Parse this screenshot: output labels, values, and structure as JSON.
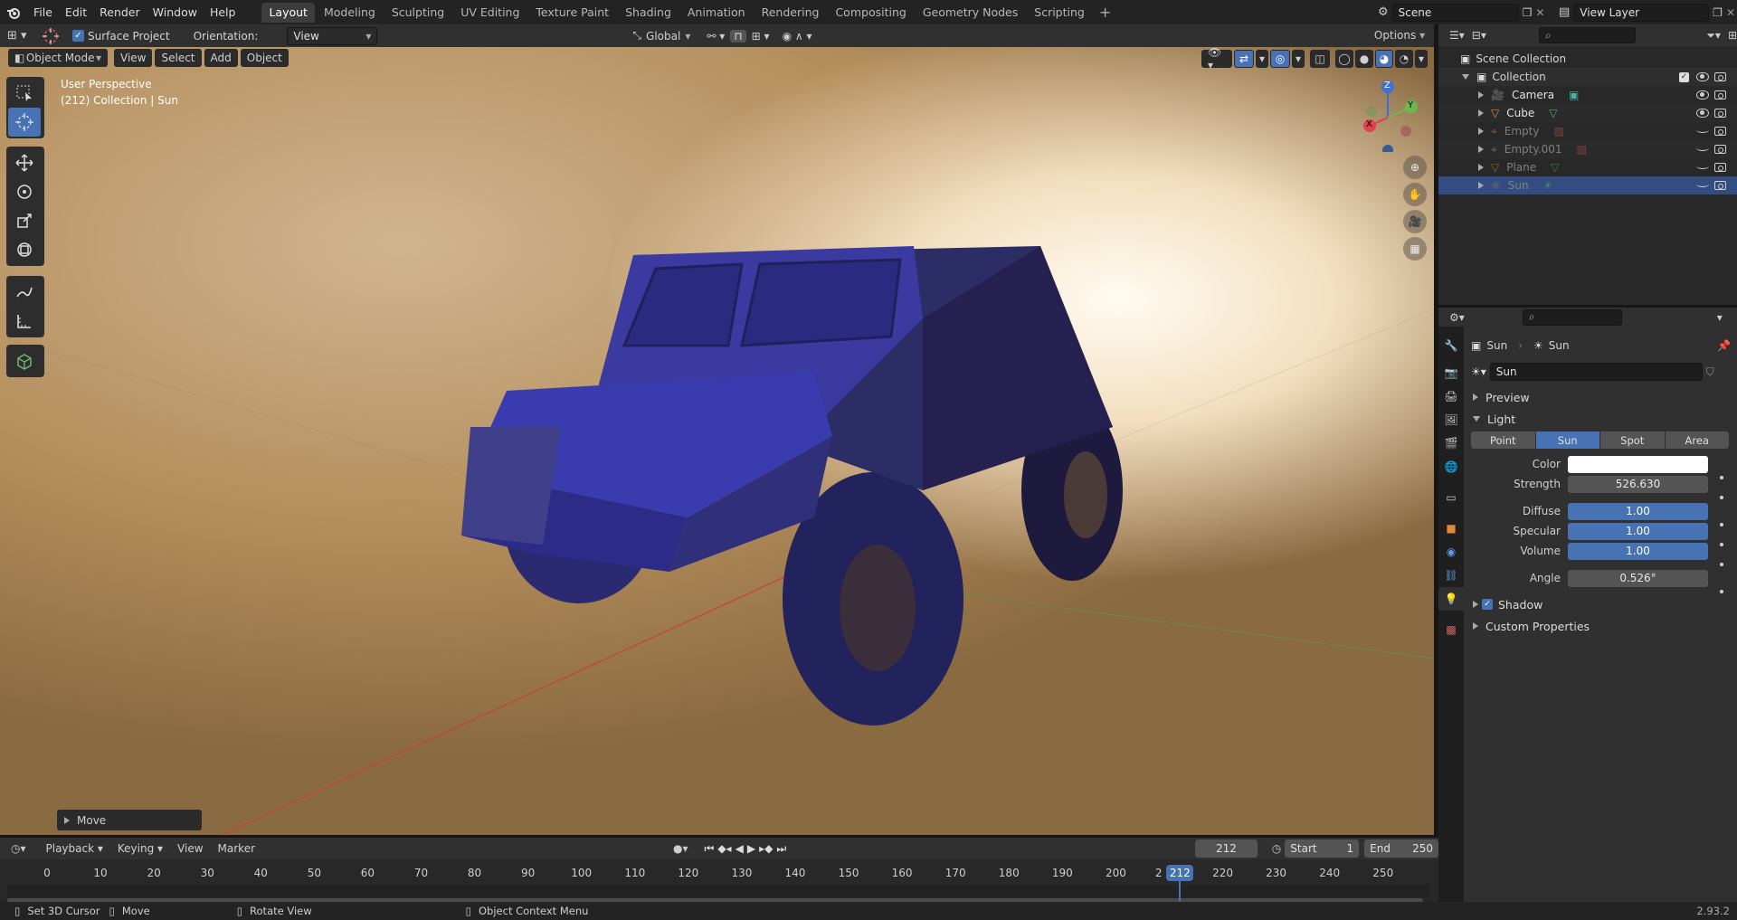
{
  "topbar": {
    "menus": [
      "File",
      "Edit",
      "Render",
      "Window",
      "Help"
    ],
    "workspaces": [
      "Layout",
      "Modeling",
      "Sculpting",
      "UV Editing",
      "Texture Paint",
      "Shading",
      "Animation",
      "Rendering",
      "Compositing",
      "Geometry Nodes",
      "Scripting"
    ],
    "active_workspace": "Layout",
    "scene": "Scene",
    "view_layer": "View Layer"
  },
  "tool_header": {
    "surface_project_label": "Surface Project",
    "orientation_label": "Orientation:",
    "orientation_value": "View",
    "transform_orientation": "Global",
    "options_label": "Options"
  },
  "viewport_header": {
    "mode": "Object Mode",
    "menus": [
      "View",
      "Select",
      "Add",
      "Object"
    ]
  },
  "viewport": {
    "perspective_label": "User Perspective",
    "context_label": "(212) Collection | Sun",
    "gizmo": {
      "x": "X",
      "y": "Y",
      "z": "Z"
    },
    "last_operator": "Move"
  },
  "outliner": {
    "scene_collection": "Scene Collection",
    "collection": "Collection",
    "items": [
      {
        "name": "Camera",
        "icon": "camera-icon",
        "data_icon": "camera-data-icon",
        "visible": true,
        "selected": false
      },
      {
        "name": "Cube",
        "icon": "mesh-icon",
        "data_icon": "mesh-data-icon",
        "visible": true,
        "selected": false
      },
      {
        "name": "Empty",
        "icon": "empty-icon",
        "data_icon": "image-icon",
        "visible": false,
        "selected": false
      },
      {
        "name": "Empty.001",
        "icon": "empty-icon",
        "data_icon": "image-icon",
        "visible": false,
        "selected": false
      },
      {
        "name": "Plane",
        "icon": "mesh-icon",
        "data_icon": "mesh-data-icon",
        "visible": false,
        "selected": false
      },
      {
        "name": "Sun",
        "icon": "light-icon",
        "data_icon": "sun-data-icon",
        "visible": false,
        "selected": true
      }
    ]
  },
  "properties": {
    "breadcrumb_object": "Sun",
    "breadcrumb_data": "Sun",
    "datablock_name": "Sun",
    "sections": {
      "preview": "Preview",
      "light": "Light",
      "shadow": "Shadow",
      "custom": "Custom Properties"
    },
    "light_types": [
      "Point",
      "Sun",
      "Spot",
      "Area"
    ],
    "active_light_type": "Sun",
    "color_label": "Color",
    "color_value": "#ffffff",
    "strength_label": "Strength",
    "strength_value": "526.630",
    "diffuse_label": "Diffuse",
    "diffuse_value": "1.00",
    "specular_label": "Specular",
    "specular_value": "1.00",
    "volume_label": "Volume",
    "volume_value": "1.00",
    "angle_label": "Angle",
    "angle_value": "0.526°",
    "shadow_enabled": true
  },
  "timeline": {
    "menus": [
      "Playback",
      "Keying",
      "View",
      "Marker"
    ],
    "current_frame": "212",
    "start_label": "Start",
    "start_value": "1",
    "end_label": "End",
    "end_value": "250",
    "ticks": [
      "0",
      "10",
      "20",
      "30",
      "40",
      "50",
      "60",
      "70",
      "80",
      "90",
      "100",
      "110",
      "120",
      "130",
      "140",
      "150",
      "160",
      "170",
      "180",
      "190",
      "200",
      "2",
      "220",
      "230",
      "240",
      "250"
    ],
    "playhead_label": "212"
  },
  "statusbar": {
    "items": [
      "Set 3D Cursor",
      "Move",
      "Rotate View",
      "Object Context Menu"
    ],
    "version": "2.93.2"
  },
  "colors": {
    "accent": "#4772b3",
    "selected_row": "#334d80"
  }
}
